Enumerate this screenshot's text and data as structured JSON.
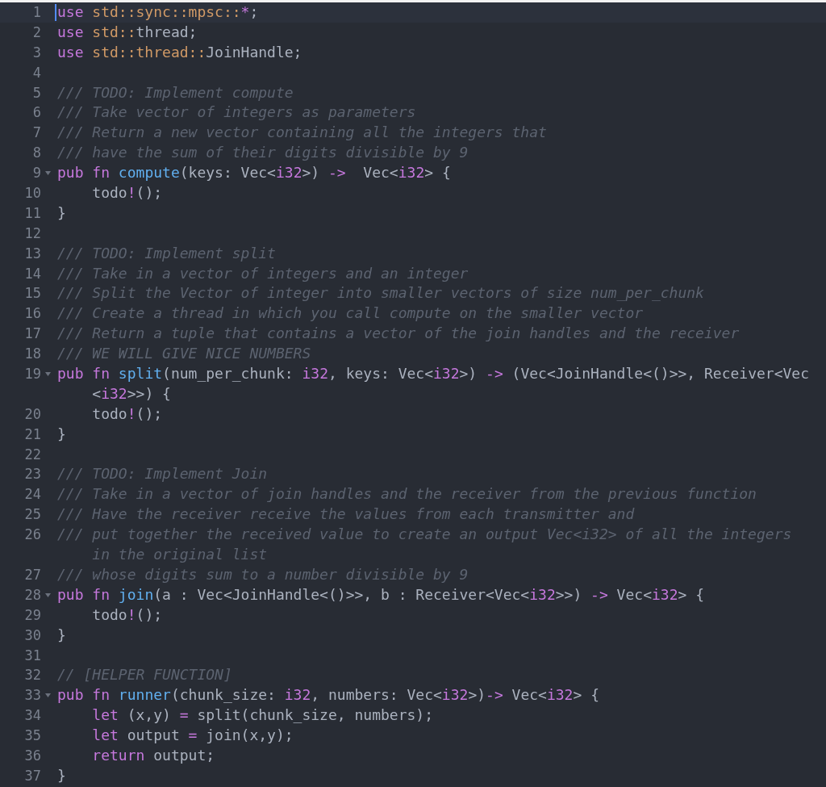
{
  "editor": {
    "lines": [
      {
        "n": "1",
        "fold": false,
        "active": true,
        "segments": [
          {
            "tokens": [
              {
                "kind": "kw",
                "text": "use"
              },
              {
                "kind": "path",
                "text": " std::sync::mpsc::"
              },
              {
                "kind": "op",
                "text": "*"
              },
              {
                "kind": "plain",
                "text": ";"
              }
            ]
          }
        ]
      },
      {
        "n": "2",
        "fold": false,
        "active": false,
        "segments": [
          {
            "tokens": [
              {
                "kind": "kw",
                "text": "use"
              },
              {
                "kind": "path",
                "text": " std::"
              },
              {
                "kind": "plain",
                "text": "thread;"
              }
            ]
          }
        ]
      },
      {
        "n": "3",
        "fold": false,
        "active": false,
        "segments": [
          {
            "tokens": [
              {
                "kind": "kw",
                "text": "use"
              },
              {
                "kind": "path",
                "text": " std::thread::"
              },
              {
                "kind": "plain",
                "text": "JoinHandle;"
              }
            ]
          }
        ]
      },
      {
        "n": "4",
        "fold": false,
        "active": false
      },
      {
        "n": "5",
        "fold": false,
        "active": false,
        "segments": [
          {
            "tokens": [
              {
                "kind": "comment",
                "text": "/// TODO: Implement compute"
              }
            ]
          }
        ]
      },
      {
        "n": "6",
        "fold": false,
        "active": false,
        "segments": [
          {
            "tokens": [
              {
                "kind": "comment",
                "text": "/// Take vector of integers as parameters"
              }
            ]
          }
        ]
      },
      {
        "n": "7",
        "fold": false,
        "active": false,
        "segments": [
          {
            "tokens": [
              {
                "kind": "comment",
                "text": "/// Return a new vector containing all the integers that"
              }
            ]
          }
        ]
      },
      {
        "n": "8",
        "fold": false,
        "active": false,
        "segments": [
          {
            "tokens": [
              {
                "kind": "comment",
                "text": "/// have the sum of their digits divisible by 9"
              }
            ]
          }
        ]
      },
      {
        "n": "9",
        "fold": true,
        "active": false,
        "segments": [
          {
            "tokens": [
              {
                "kind": "kw",
                "text": "pub fn"
              },
              {
                "kind": "fn",
                "text": " compute"
              },
              {
                "kind": "plain",
                "text": "(keys: Vec<"
              },
              {
                "kind": "type",
                "text": "i32"
              },
              {
                "kind": "plain",
                "text": ">) "
              },
              {
                "kind": "op",
                "text": "->"
              },
              {
                "kind": "plain",
                "text": "  Vec<"
              },
              {
                "kind": "type",
                "text": "i32"
              },
              {
                "kind": "plain",
                "text": "> {"
              }
            ]
          }
        ]
      },
      {
        "n": "10",
        "fold": false,
        "active": false,
        "segments": [
          {
            "tokens": [
              {
                "kind": "plain",
                "text": "    todo"
              },
              {
                "kind": "op",
                "text": "!"
              },
              {
                "kind": "plain",
                "text": "();"
              }
            ]
          }
        ]
      },
      {
        "n": "11",
        "fold": false,
        "active": false,
        "segments": [
          {
            "tokens": [
              {
                "kind": "plain",
                "text": "}"
              }
            ]
          }
        ]
      },
      {
        "n": "12",
        "fold": false,
        "active": false
      },
      {
        "n": "13",
        "fold": false,
        "active": false,
        "segments": [
          {
            "tokens": [
              {
                "kind": "comment",
                "text": "/// TODO: Implement split"
              }
            ]
          }
        ]
      },
      {
        "n": "14",
        "fold": false,
        "active": false,
        "segments": [
          {
            "tokens": [
              {
                "kind": "comment",
                "text": "/// Take in a vector of integers and an integer"
              }
            ]
          }
        ]
      },
      {
        "n": "15",
        "fold": false,
        "active": false,
        "segments": [
          {
            "tokens": [
              {
                "kind": "comment",
                "text": "/// Split the Vector of integer into smaller vectors of size num_per_chunk"
              }
            ]
          }
        ]
      },
      {
        "n": "16",
        "fold": false,
        "active": false,
        "segments": [
          {
            "tokens": [
              {
                "kind": "comment",
                "text": "/// Create a thread in which you call compute on the smaller vector"
              }
            ]
          }
        ]
      },
      {
        "n": "17",
        "fold": false,
        "active": false,
        "segments": [
          {
            "tokens": [
              {
                "kind": "comment",
                "text": "/// Return a tuple that contains a vector of the join handles and the receiver"
              }
            ]
          }
        ]
      },
      {
        "n": "18",
        "fold": false,
        "active": false,
        "segments": [
          {
            "tokens": [
              {
                "kind": "comment",
                "text": "/// WE WILL GIVE NICE NUMBERS"
              }
            ]
          }
        ]
      },
      {
        "n": "19",
        "fold": true,
        "active": false,
        "segments": [
          {
            "tokens": [
              {
                "kind": "kw",
                "text": "pub fn"
              },
              {
                "kind": "fn",
                "text": " split"
              },
              {
                "kind": "plain",
                "text": "(num_per_chunk: "
              },
              {
                "kind": "type",
                "text": "i32"
              },
              {
                "kind": "plain",
                "text": ", keys: Vec<"
              },
              {
                "kind": "type",
                "text": "i32"
              },
              {
                "kind": "plain",
                "text": ">) "
              },
              {
                "kind": "op",
                "text": "->"
              },
              {
                "kind": "plain",
                "text": " (Vec<JoinHandle<()>>, Receiver<Vec"
              }
            ]
          },
          {
            "tokens": [
              {
                "kind": "plain",
                "text": "<"
              },
              {
                "kind": "type",
                "text": "i32"
              },
              {
                "kind": "plain",
                "text": ">>) {"
              }
            ]
          }
        ]
      },
      {
        "n": "20",
        "fold": false,
        "active": false,
        "segments": [
          {
            "tokens": [
              {
                "kind": "plain",
                "text": "    todo"
              },
              {
                "kind": "op",
                "text": "!"
              },
              {
                "kind": "plain",
                "text": "();"
              }
            ]
          }
        ]
      },
      {
        "n": "21",
        "fold": false,
        "active": false,
        "segments": [
          {
            "tokens": [
              {
                "kind": "plain",
                "text": "}"
              }
            ]
          }
        ]
      },
      {
        "n": "22",
        "fold": false,
        "active": false
      },
      {
        "n": "23",
        "fold": false,
        "active": false,
        "segments": [
          {
            "tokens": [
              {
                "kind": "comment",
                "text": "/// TODO: Implement Join"
              }
            ]
          }
        ]
      },
      {
        "n": "24",
        "fold": false,
        "active": false,
        "segments": [
          {
            "tokens": [
              {
                "kind": "comment",
                "text": "/// Take in a vector of join handles and the receiver from the previous function"
              }
            ]
          }
        ]
      },
      {
        "n": "25",
        "fold": false,
        "active": false,
        "segments": [
          {
            "tokens": [
              {
                "kind": "comment",
                "text": "/// Have the receiver receive the values from each transmitter and"
              }
            ]
          }
        ]
      },
      {
        "n": "26",
        "fold": false,
        "active": false,
        "segments": [
          {
            "tokens": [
              {
                "kind": "comment",
                "text": "/// put together the received value to create an output Vec<i32> of all the integers"
              }
            ]
          },
          {
            "tokens": [
              {
                "kind": "comment",
                "text": "in the original list"
              }
            ]
          }
        ]
      },
      {
        "n": "27",
        "fold": false,
        "active": false,
        "segments": [
          {
            "tokens": [
              {
                "kind": "comment",
                "text": "/// whose digits sum to a number divisible by 9"
              }
            ]
          }
        ]
      },
      {
        "n": "28",
        "fold": true,
        "active": false,
        "segments": [
          {
            "tokens": [
              {
                "kind": "kw",
                "text": "pub fn"
              },
              {
                "kind": "fn",
                "text": " join"
              },
              {
                "kind": "plain",
                "text": "(a : Vec<JoinHandle<()>>, b : Receiver<Vec<"
              },
              {
                "kind": "type",
                "text": "i32"
              },
              {
                "kind": "plain",
                "text": ">>) "
              },
              {
                "kind": "op",
                "text": "->"
              },
              {
                "kind": "plain",
                "text": " Vec<"
              },
              {
                "kind": "type",
                "text": "i32"
              },
              {
                "kind": "plain",
                "text": "> {"
              }
            ]
          }
        ]
      },
      {
        "n": "29",
        "fold": false,
        "active": false,
        "segments": [
          {
            "tokens": [
              {
                "kind": "plain",
                "text": "    todo"
              },
              {
                "kind": "op",
                "text": "!"
              },
              {
                "kind": "plain",
                "text": "();"
              }
            ]
          }
        ]
      },
      {
        "n": "30",
        "fold": false,
        "active": false,
        "segments": [
          {
            "tokens": [
              {
                "kind": "plain",
                "text": "}"
              }
            ]
          }
        ]
      },
      {
        "n": "31",
        "fold": false,
        "active": false
      },
      {
        "n": "32",
        "fold": false,
        "active": false,
        "segments": [
          {
            "tokens": [
              {
                "kind": "comment",
                "text": "// [HELPER FUNCTION]"
              }
            ]
          }
        ]
      },
      {
        "n": "33",
        "fold": true,
        "active": false,
        "segments": [
          {
            "tokens": [
              {
                "kind": "kw",
                "text": "pub fn"
              },
              {
                "kind": "fn",
                "text": " runner"
              },
              {
                "kind": "plain",
                "text": "(chunk_size: "
              },
              {
                "kind": "type",
                "text": "i32"
              },
              {
                "kind": "plain",
                "text": ", numbers: Vec<"
              },
              {
                "kind": "type",
                "text": "i32"
              },
              {
                "kind": "plain",
                "text": ">)"
              },
              {
                "kind": "op",
                "text": "->"
              },
              {
                "kind": "plain",
                "text": " Vec<"
              },
              {
                "kind": "type",
                "text": "i32"
              },
              {
                "kind": "plain",
                "text": "> {"
              }
            ]
          }
        ]
      },
      {
        "n": "34",
        "fold": false,
        "active": false,
        "segments": [
          {
            "tokens": [
              {
                "kind": "kw",
                "text": "    let"
              },
              {
                "kind": "plain",
                "text": " (x,y) "
              },
              {
                "kind": "op",
                "text": "="
              },
              {
                "kind": "plain",
                "text": " split(chunk_size, numbers);"
              }
            ]
          }
        ]
      },
      {
        "n": "35",
        "fold": false,
        "active": false,
        "segments": [
          {
            "tokens": [
              {
                "kind": "kw",
                "text": "    let"
              },
              {
                "kind": "plain",
                "text": " output "
              },
              {
                "kind": "op",
                "text": "="
              },
              {
                "kind": "plain",
                "text": " join(x,y);"
              }
            ]
          }
        ]
      },
      {
        "n": "36",
        "fold": false,
        "active": false,
        "segments": [
          {
            "tokens": [
              {
                "kind": "kw",
                "text": "    return"
              },
              {
                "kind": "plain",
                "text": " output;"
              }
            ]
          }
        ]
      },
      {
        "n": "37",
        "fold": false,
        "active": false,
        "segments": [
          {
            "tokens": [
              {
                "kind": "plain",
                "text": "}"
              }
            ]
          }
        ]
      }
    ]
  }
}
